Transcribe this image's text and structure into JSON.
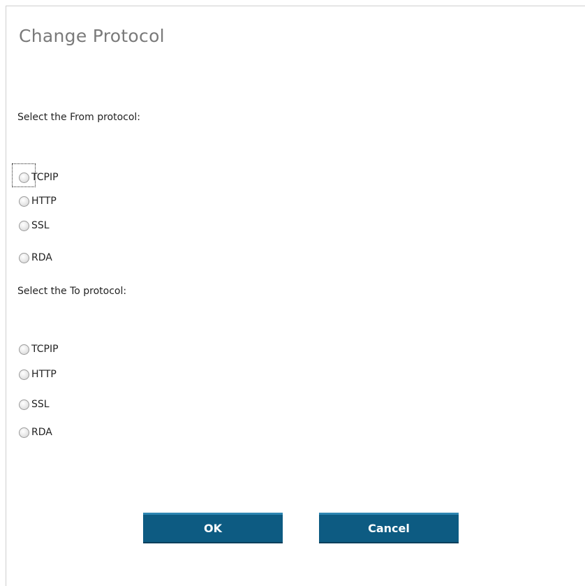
{
  "dialog": {
    "title": "Change Protocol"
  },
  "from_section": {
    "label": "Select the From protocol:",
    "options": [
      {
        "label": "TCPIP",
        "selected": false,
        "focused": true
      },
      {
        "label": "HTTP",
        "selected": false
      },
      {
        "label": "SSL",
        "selected": false
      },
      {
        "label": "RDA",
        "selected": false
      }
    ]
  },
  "to_section": {
    "label": "Select the To protocol:",
    "options": [
      {
        "label": "TCPIP",
        "selected": false
      },
      {
        "label": "HTTP",
        "selected": false
      },
      {
        "label": "SSL",
        "selected": false
      },
      {
        "label": "RDA",
        "selected": false
      }
    ]
  },
  "buttons": {
    "ok_label": "OK",
    "cancel_label": "Cancel"
  },
  "colors": {
    "button_bg": "#0d5b82",
    "title_text": "#7a7a7a",
    "body_text": "#222222"
  }
}
